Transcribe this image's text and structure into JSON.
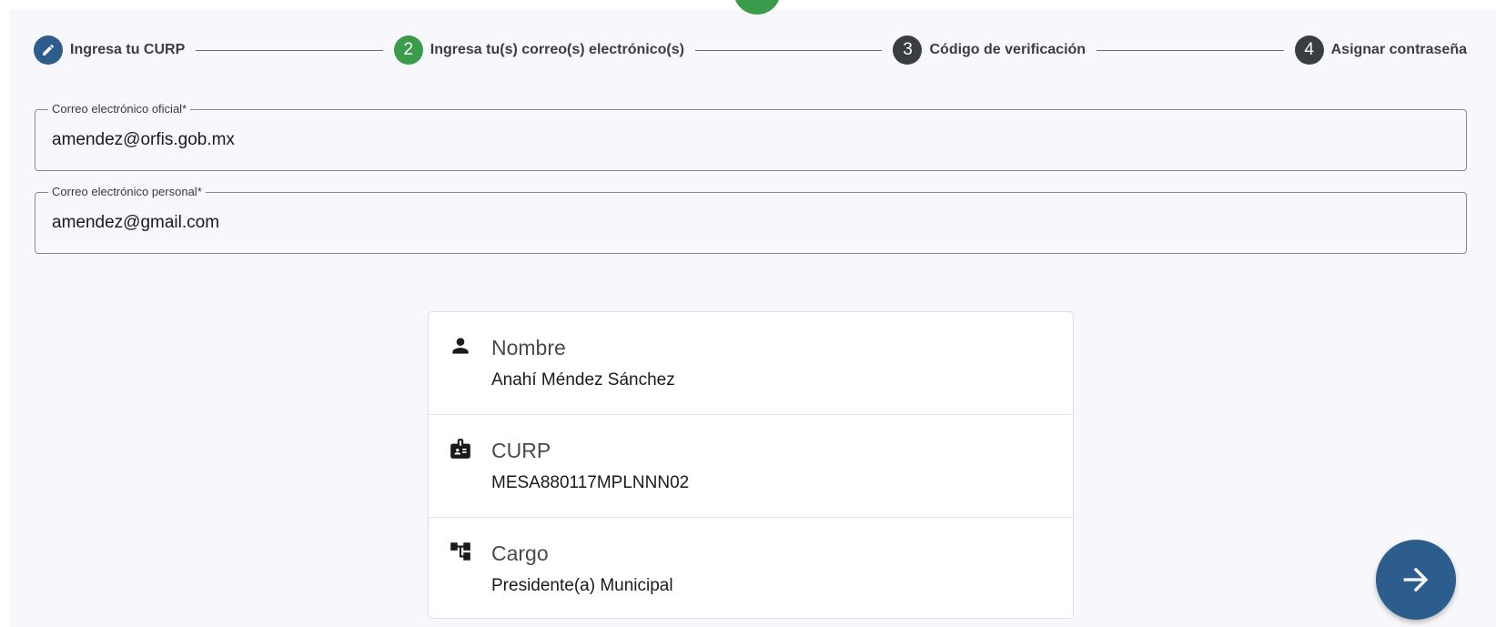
{
  "colors": {
    "primary": "#2d5d8c",
    "active": "#3a9c4a",
    "pending": "#3a3d42",
    "background": "#f8f8fc"
  },
  "stepper": {
    "steps": [
      {
        "number": "",
        "icon": "pencil-icon",
        "label": "Ingresa tu CURP",
        "state": "done"
      },
      {
        "number": "2",
        "label": "Ingresa tu(s) correo(s) electrónico(s)",
        "state": "active"
      },
      {
        "number": "3",
        "label": "Código de verificación",
        "state": "pending"
      },
      {
        "number": "4",
        "label": "Asignar contraseña",
        "state": "pending"
      }
    ]
  },
  "form": {
    "official_email": {
      "label": "Correo electrónico oficial*",
      "value": "amendez@orfis.gob.mx"
    },
    "personal_email": {
      "label": "Correo electrónico personal*",
      "value": "amendez@gmail.com"
    }
  },
  "card": {
    "rows": [
      {
        "icon": "person-icon",
        "title": "Nombre",
        "value": "Anahí Méndez Sánchez"
      },
      {
        "icon": "id-badge-icon",
        "title": "CURP",
        "value": "MESA880117MPLNNN02"
      },
      {
        "icon": "org-chart-icon",
        "title": "Cargo",
        "value": "Presidente(a) Municipal"
      }
    ]
  },
  "next_button": {
    "icon": "arrow-right-icon"
  }
}
